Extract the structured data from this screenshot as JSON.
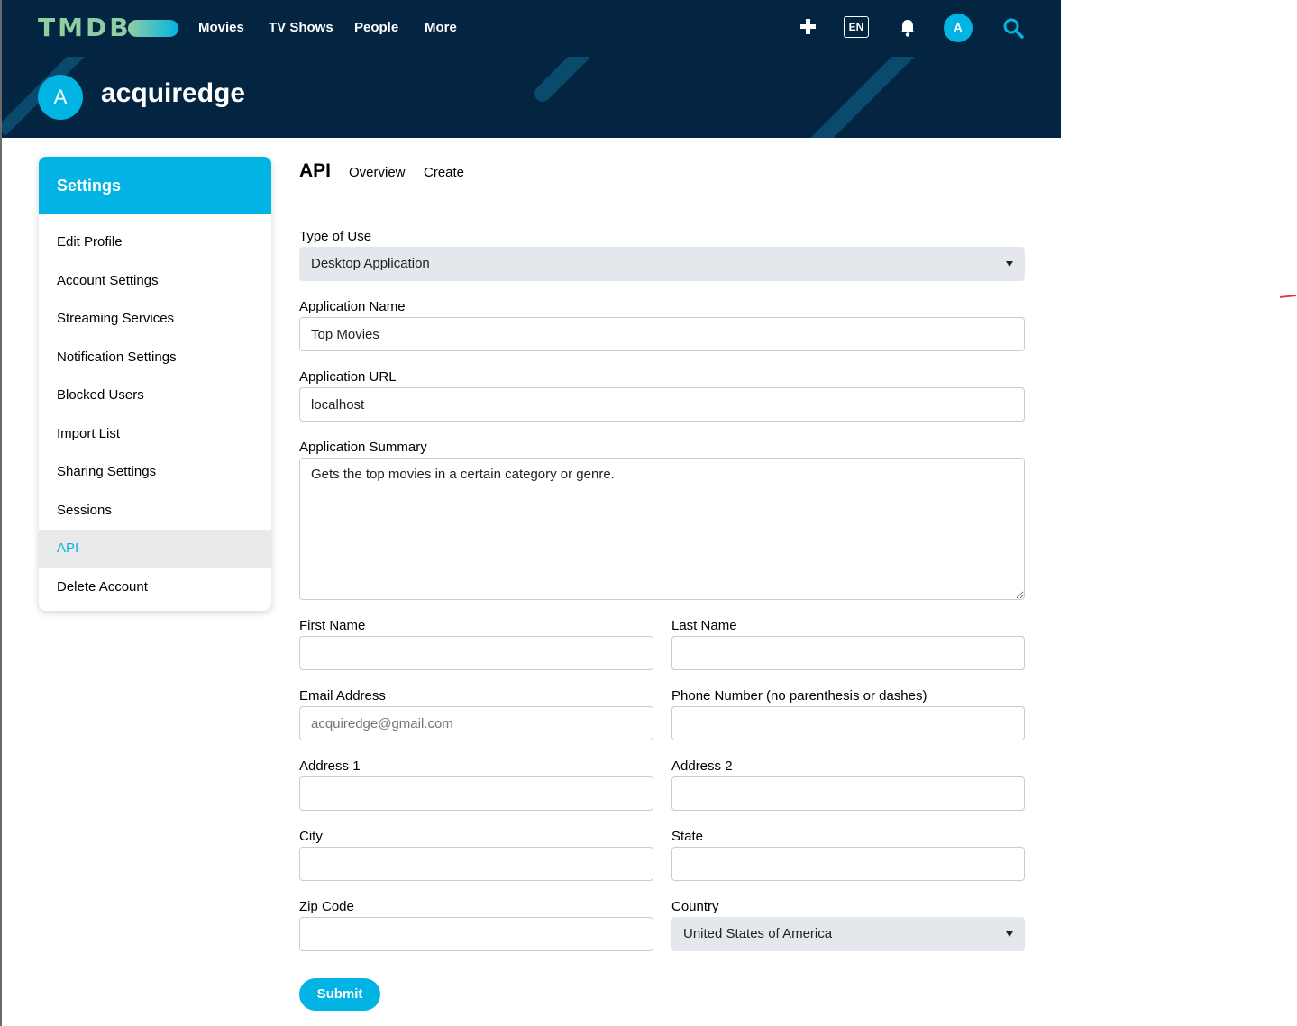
{
  "nav": {
    "logo": "TMDB",
    "items": [
      "Movies",
      "TV Shows",
      "People",
      "More"
    ],
    "language": "EN",
    "avatar_initial": "A"
  },
  "profile": {
    "avatar_initial": "A",
    "username": "acquiredge"
  },
  "sidebar": {
    "title": "Settings",
    "items": [
      {
        "label": "Edit Profile"
      },
      {
        "label": "Account Settings"
      },
      {
        "label": "Streaming Services"
      },
      {
        "label": "Notification Settings"
      },
      {
        "label": "Blocked Users"
      },
      {
        "label": "Import List"
      },
      {
        "label": "Sharing Settings"
      },
      {
        "label": "Sessions"
      },
      {
        "label": "API"
      },
      {
        "label": "Delete Account"
      }
    ],
    "active": "API"
  },
  "page": {
    "title": "API",
    "tabs": [
      "Overview",
      "Create"
    ]
  },
  "form": {
    "type_of_use": {
      "label": "Type of Use",
      "value": "Desktop Application"
    },
    "app_name": {
      "label": "Application Name",
      "value": "Top Movies"
    },
    "app_url": {
      "label": "Application URL",
      "value": "localhost"
    },
    "app_summary": {
      "label": "Application Summary",
      "value": "Gets the top movies in a certain category or genre."
    },
    "first_name": {
      "label": "First Name",
      "value": ""
    },
    "last_name": {
      "label": "Last Name",
      "value": ""
    },
    "email": {
      "label": "Email Address",
      "placeholder": "acquiredge@gmail.com"
    },
    "phone": {
      "label": "Phone Number (no parenthesis or dashes)",
      "value": ""
    },
    "address1": {
      "label": "Address 1",
      "value": ""
    },
    "address2": {
      "label": "Address 2",
      "value": ""
    },
    "city": {
      "label": "City",
      "value": ""
    },
    "state": {
      "label": "State",
      "value": ""
    },
    "zip": {
      "label": "Zip Code",
      "value": ""
    },
    "country": {
      "label": "Country",
      "value": "United States of America"
    },
    "submit_label": "Submit"
  },
  "colors": {
    "nav_bg": "#032541",
    "accent": "#01b4e4",
    "logo_green": "#90cea1"
  },
  "icons": [
    "plus-icon",
    "bell-icon",
    "search-icon",
    "chevron-down-icon"
  ]
}
